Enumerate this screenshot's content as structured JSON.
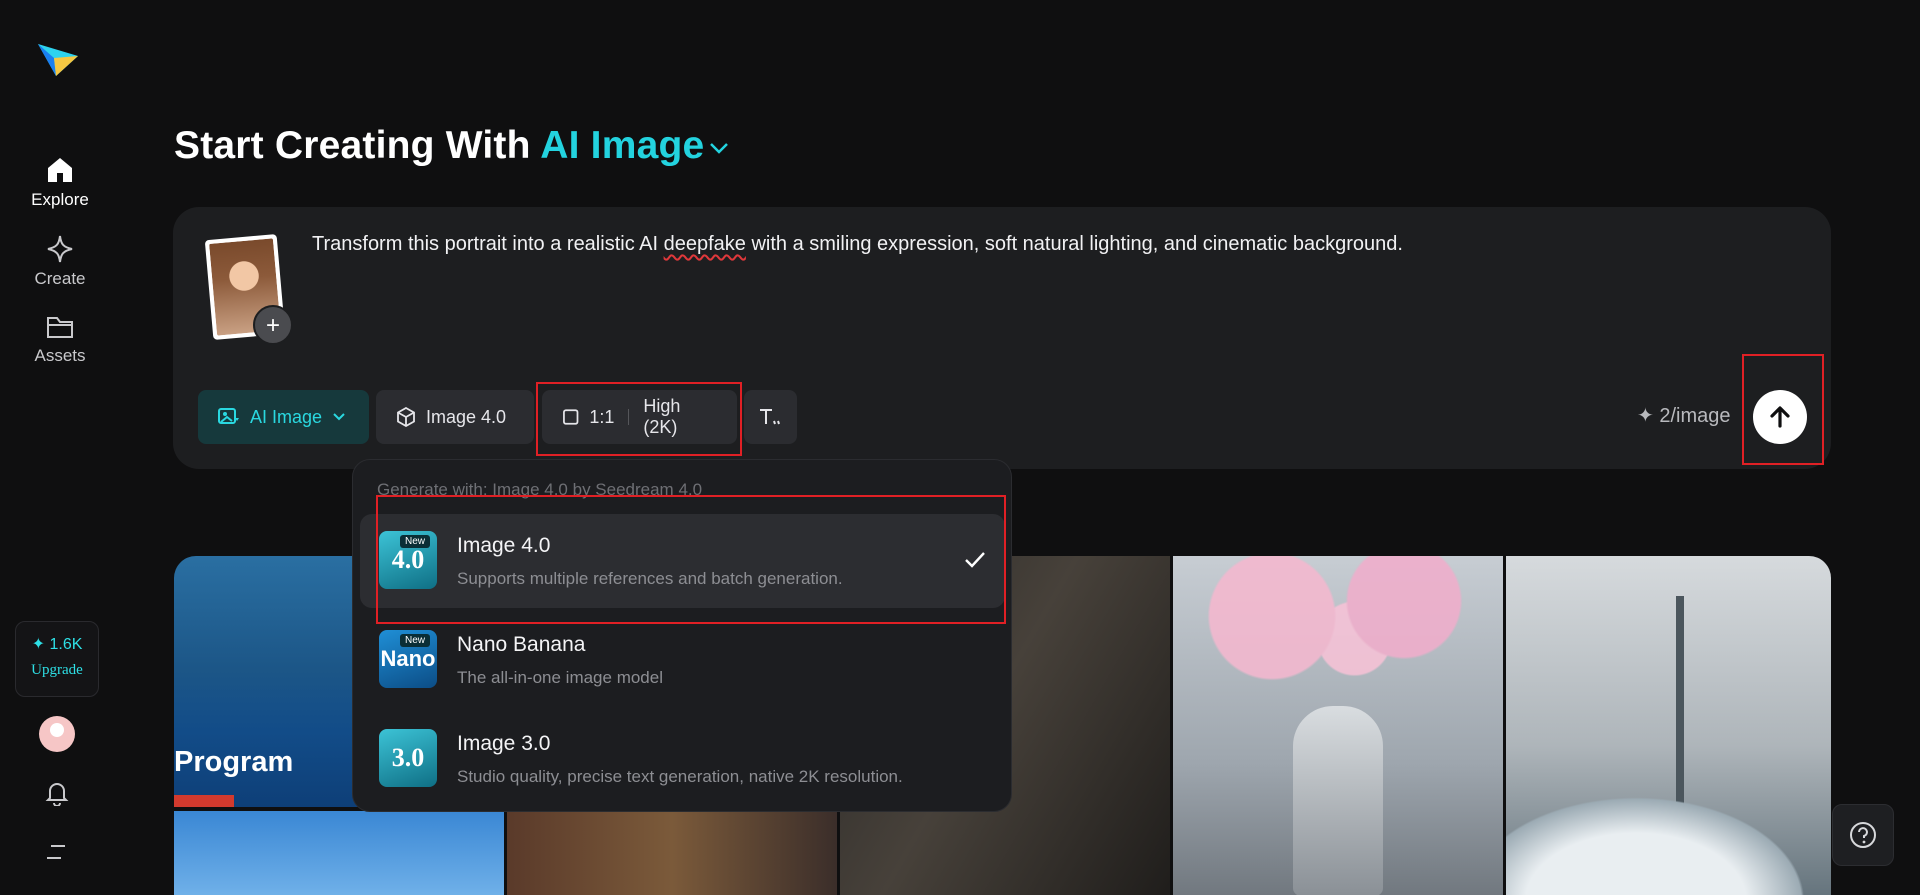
{
  "sidebar": {
    "logo_icon": "paper-plane-logo",
    "items": [
      {
        "label": "Explore",
        "icon": "home-icon",
        "active": true
      },
      {
        "label": "Create",
        "icon": "sparkle-icon",
        "active": false
      },
      {
        "label": "Assets",
        "icon": "folder-icon",
        "active": false
      }
    ],
    "upgrade": {
      "credits": "1.6K",
      "label": "Upgrade"
    }
  },
  "header": {
    "title_prefix": "Start Creating With ",
    "title_accent": "AI Image"
  },
  "composer": {
    "prompt": {
      "before": "Transform this portrait into a realistic AI ",
      "misspelled": "deepfake",
      "after": " with a smiling expression, soft natural lighting, and cinematic background."
    },
    "add_reference": "+",
    "chips": {
      "mode": "AI Image",
      "model": "Image 4.0",
      "ratio": "1:1",
      "quality": "High (2K)"
    },
    "cost": "2/image"
  },
  "gallery": {
    "promo_text": "Program"
  },
  "model_dropdown": {
    "header": "Generate with: Image 4.0 by Seedream 4.0",
    "items": [
      {
        "name": "Image 4.0",
        "description": "Supports multiple references and batch generation.",
        "icon_text": "4.0",
        "badge": "New",
        "selected": true
      },
      {
        "name": "Nano Banana",
        "description": "The all-in-one image model",
        "icon_text": "Nano",
        "badge": "New",
        "selected": false
      },
      {
        "name": "Image 3.0",
        "description": "Studio quality, precise text generation, native 2K resolution.",
        "icon_text": "3.0",
        "badge": "",
        "selected": false
      }
    ]
  },
  "colors": {
    "accent": "#23d3df",
    "highlight": "#e02025",
    "background": "#0f0f10",
    "panel": "#1d1e20"
  }
}
